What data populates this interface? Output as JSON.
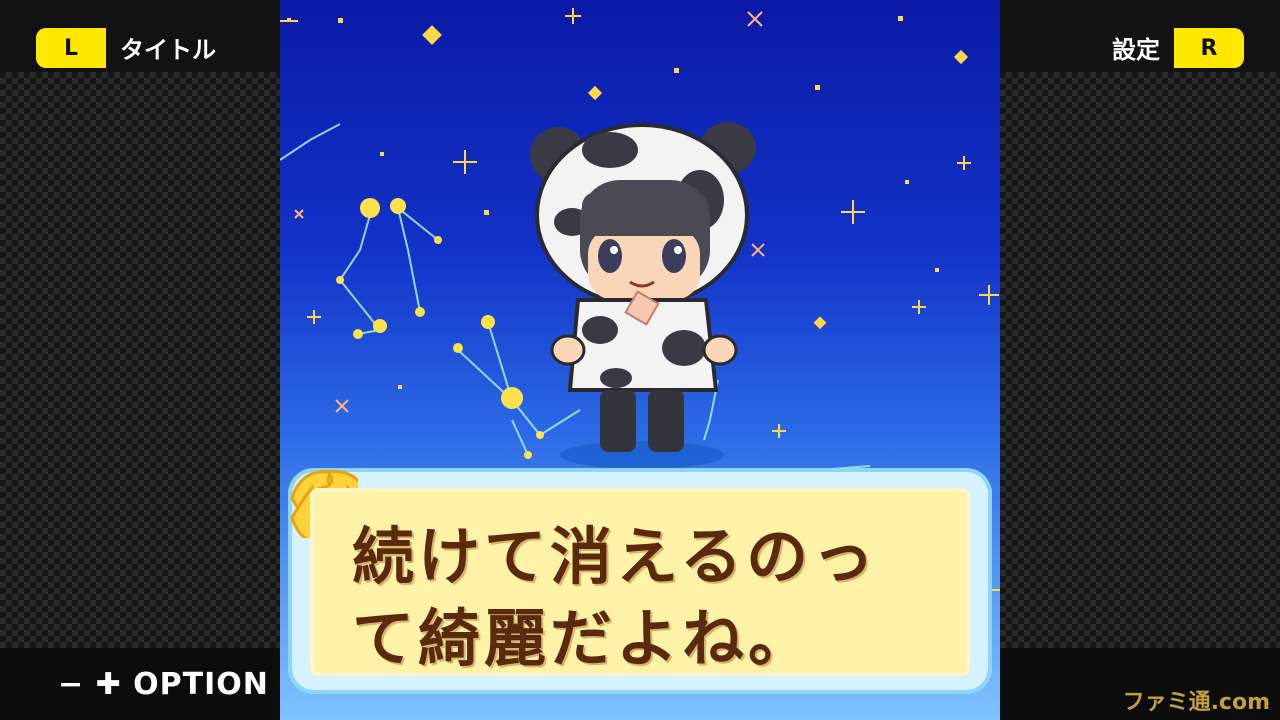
{
  "hud": {
    "left_button": "L",
    "left_label": "タイトル",
    "right_label": "設定",
    "right_button": "R",
    "option_label": "− ✚ OPTION"
  },
  "dialog": {
    "line1": "続けて消えるのっ",
    "line2": "て綺麗だよね。"
  },
  "watermark": "ファミ通.com",
  "colors": {
    "accent_yellow": "#ffe800",
    "dialog_bg": "#fdf2a6",
    "dialog_text": "#5a2a10",
    "sky_top": "#0b1aa6",
    "sky_bottom": "#7ec3ff"
  }
}
